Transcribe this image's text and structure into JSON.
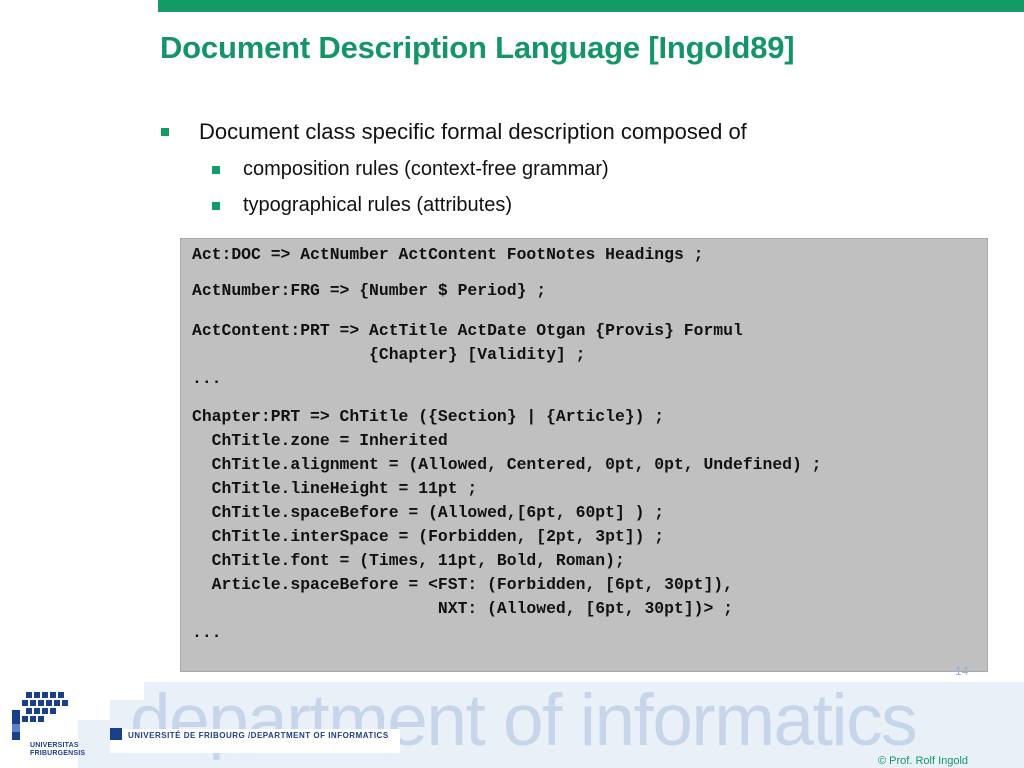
{
  "slide": {
    "title": "Document Description Language [Ingold89]",
    "bullets": [
      {
        "level": 1,
        "text": "Document class specific formal description composed of"
      },
      {
        "level": 2,
        "text": "composition rules (context-free grammar)"
      },
      {
        "level": 2,
        "text": "typographical rules (attributes)"
      }
    ],
    "code_lines": [
      "Act:DOC => ActNumber ActContent FootNotes Headings ;",
      "ActNumber:FRG => {Number $ Period} ;",
      "ActContent:PRT => ActTitle ActDate Otgan {Provis} Formul",
      "                  {Chapter} [Validity] ;",
      "...",
      "Chapter:PRT => ChTitle ({Section} | {Article}) ;",
      "  ChTitle.zone = Inherited",
      "  ChTitle.alignment = (Allowed, Centered, 0pt, 0pt, Undefined) ;",
      "  ChTitle.lineHeight = 11pt ;",
      "  ChTitle.spaceBefore = (Allowed,[6pt, 60pt] ) ;",
      "  ChTitle.interSpace = (Forbidden, [2pt, 3pt]) ;",
      "  ChTitle.font = (Times, 11pt, Bold, Roman);",
      "  Article.spaceBefore = <FST: (Forbidden, [6pt, 30pt]),",
      "                         NXT: (Allowed, [6pt, 30pt])> ;",
      "..."
    ],
    "page_number": "14"
  },
  "footer": {
    "department_watermark": "department of informatics",
    "university_label": "UNIVERSITÉ DE FRIBOURG /DEPARTMENT OF INFORMATICS",
    "logo_text_line1": "UNIVERSITAS",
    "logo_text_line2": "FRIBURGENSIS",
    "copyright": "© Prof. Rolf Ingold"
  },
  "colors": {
    "accent_green": "#129a67",
    "title_green": "#139566",
    "code_background": "#c0c0c0",
    "footer_blue": "#1a3f8a",
    "watermark_blue": "#c6d5ea"
  }
}
